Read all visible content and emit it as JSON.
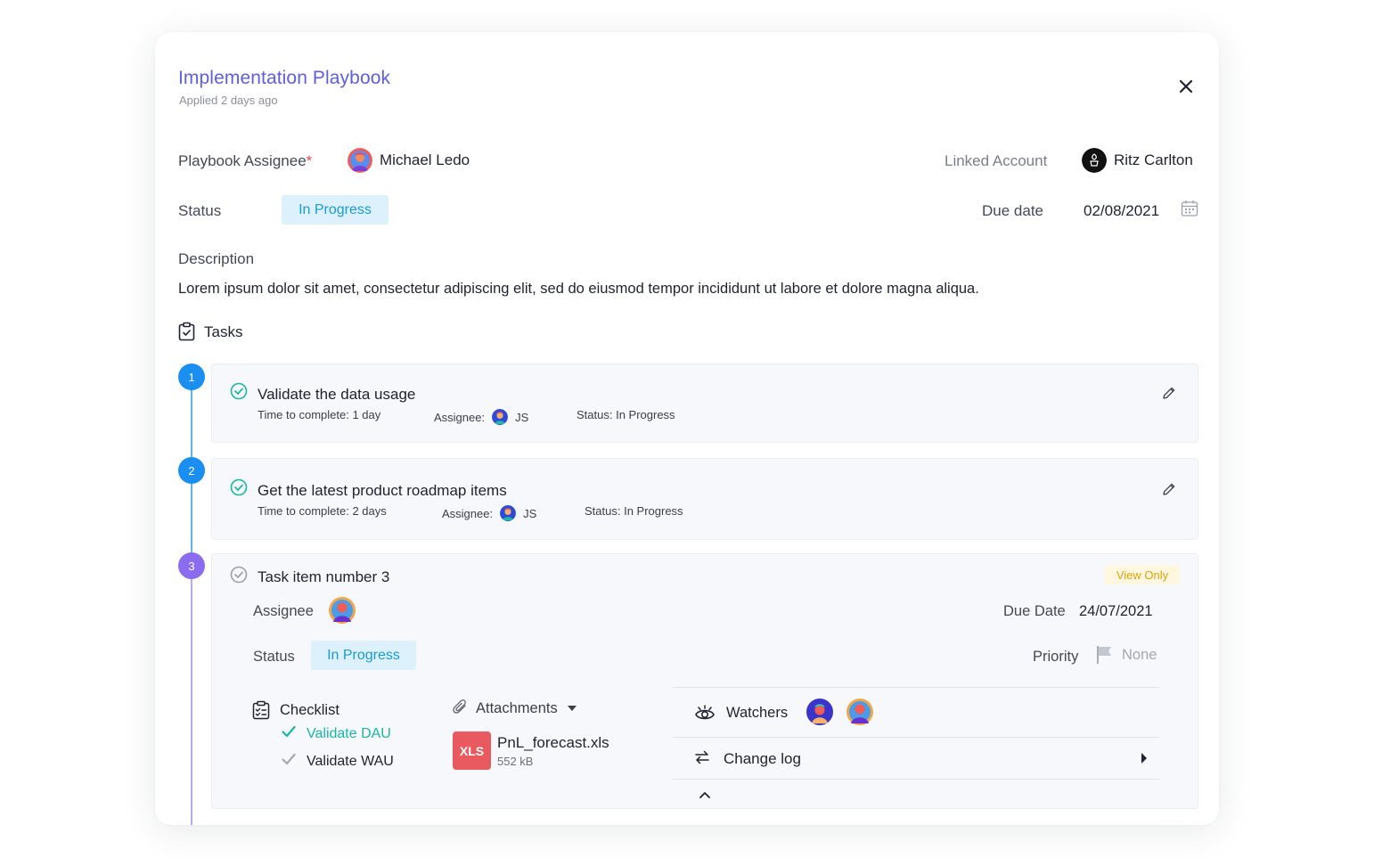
{
  "header": {
    "title": "Implementation Playbook",
    "subtitle": "Applied 2 days ago"
  },
  "fields": {
    "assignee_label": "Playbook Assignee",
    "assignee_required_mark": "*",
    "assignee_name": "Michael Ledo",
    "linked_account_label": "Linked Account",
    "linked_account_name": "Ritz Carlton",
    "status_label": "Status",
    "status_value": "In Progress",
    "due_date_label": "Due date",
    "due_date_value": "02/08/2021",
    "description_label": "Description",
    "description_text": "Lorem ipsum dolor sit amet, consectetur adipiscing elit, sed do eiusmod tempor incididunt ut labore et dolore magna aliqua."
  },
  "tasks_heading": "Tasks",
  "tasks": [
    {
      "number": "1",
      "title": "Validate the data usage",
      "time": "Time to complete: 1 day",
      "assignee_label": "Assignee:",
      "assignee_initials": "JS",
      "status": "Status: In Progress"
    },
    {
      "number": "2",
      "title": "Get the latest product roadmap items",
      "time": "Time to complete: 2 days",
      "assignee_label": "Assignee:",
      "assignee_initials": "JS",
      "status": "Status: In Progress"
    }
  ],
  "expanded_task": {
    "number": "3",
    "title": "Task item number 3",
    "badge": "View Only",
    "assignee_label": "Assignee",
    "due_date_label": "Due Date",
    "due_date_value": "24/07/2021",
    "status_label": "Status",
    "status_value": "In Progress",
    "priority_label": "Priority",
    "priority_value": "None",
    "checklist": {
      "heading": "Checklist",
      "items": [
        {
          "label": "Validate DAU",
          "done": true
        },
        {
          "label": "Validate WAU",
          "done": false
        }
      ]
    },
    "attachments": {
      "heading": "Attachments",
      "file_type": "XLS",
      "file_name": "PnL_forecast.xls",
      "file_size": "552 kB"
    },
    "watchers_label": "Watchers",
    "change_log_label": "Change log"
  },
  "colors": {
    "accent": "#5b5fe0",
    "step_blue": "#1a8ff0",
    "step_purple": "#8b6cf0",
    "status_bg": "#dcf1fb",
    "status_text": "#1b9ad4",
    "check_teal": "#17b6a6",
    "xls_red": "#e85a5f"
  },
  "icons": [
    "close-icon",
    "calendar-icon",
    "clipboard-check-icon",
    "check-circle-icon",
    "pencil-icon",
    "checklist-icon",
    "check-icon",
    "paperclip-icon",
    "caret-down-icon",
    "eye-icon",
    "swap-arrows-icon",
    "caret-right-icon",
    "chevron-up-icon",
    "flag-icon"
  ]
}
